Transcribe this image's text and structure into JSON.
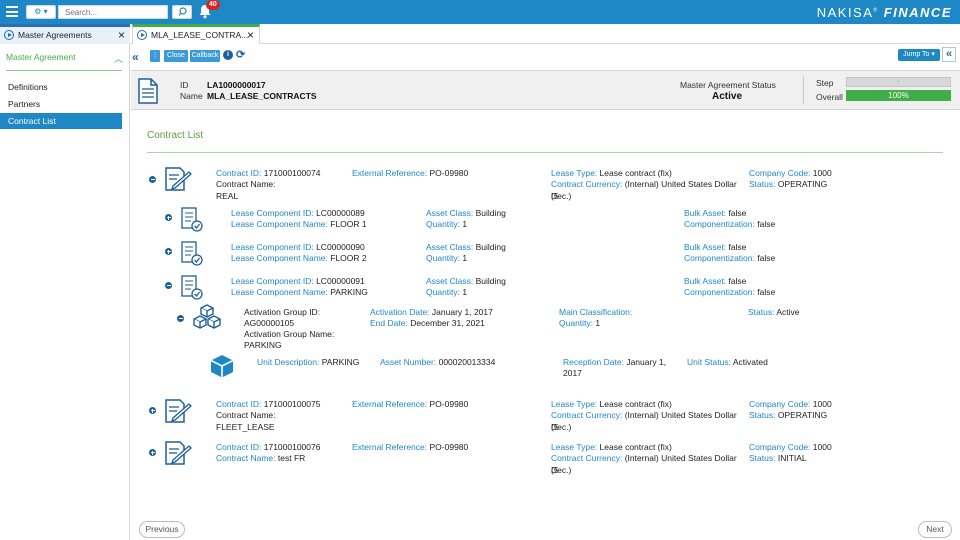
{
  "topbar": {
    "search_placeholder": "Search...",
    "notification_count": "40",
    "brand_name": "NAKISA",
    "brand_suffix": "FINANCE",
    "accent_color": "#1e88c7"
  },
  "tabs": [
    {
      "label": "Master Agreements",
      "close": "×"
    },
    {
      "label": "MLA_LEASE_CONTRA...",
      "close": "×"
    }
  ],
  "sidebar": {
    "header": "Master Agreement",
    "items": [
      {
        "label": "Definitions",
        "active": false
      },
      {
        "label": "Partners",
        "active": false
      },
      {
        "label": "Contract List",
        "active": true
      }
    ]
  },
  "toolbar": {
    "close_label": "Close",
    "callback_label": "Callback",
    "jump_label": "Jump To ▾"
  },
  "header": {
    "id_label": "ID",
    "id_value": "LA1000000017",
    "name_label": "Name",
    "name_value": "MLA_LEASE_CONTRACTS",
    "status_label": "Master Agreement Status",
    "status_value": "Active",
    "step_label": "Step",
    "step_value": "-",
    "overall_label": "Overall",
    "overall_value": "100%",
    "overall_progress": 1.0
  },
  "section_title": "Contract List",
  "contracts": [
    {
      "id_label": "Contract ID:",
      "id": "171000100074",
      "name_label": "Contract Name:",
      "name": "REAL",
      "ext_label": "External Reference:",
      "ext": "PO-09980",
      "lease_type_label": "Lease Type:",
      "lease_type": "Lease contract (fix)",
      "currency_label": "Contract Currency:",
      "currency": "(Internal) United States Dollar (5",
      "currency_cont": "Dec.)",
      "company_label": "Company Code:",
      "company": "1000",
      "status_label": "Status:",
      "status": "OPERATING"
    },
    {
      "id_label": "Contract ID:",
      "id": "171000100075",
      "name_label": "Contract Name:",
      "name": "FLEET_LEASE",
      "ext_label": "External Reference:",
      "ext": "PO-09980",
      "lease_type_label": "Lease Type:",
      "lease_type": "Lease contract (fix)",
      "currency_label": "Contract Currency:",
      "currency": "(Internal) United States Dollar (5",
      "currency_cont": "Dec.)",
      "company_label": "Company Code:",
      "company": "1000",
      "status_label": "Status:",
      "status": "OPERATING"
    },
    {
      "id_label": "Contract ID:",
      "id": "171000100076",
      "name_label": "Contract Name:",
      "name": "test FR",
      "ext_label": "External Reference:",
      "ext": "PO-09980",
      "lease_type_label": "Lease Type:",
      "lease_type": "Lease contract (fix)",
      "currency_label": "Contract Currency:",
      "currency": "(Internal) United States Dollar (5",
      "currency_cont": "Dec.)",
      "company_label": "Company Code:",
      "company": "1000",
      "status_label": "Status:",
      "status": "INITIAL"
    }
  ],
  "components": [
    {
      "id_label": "Lease Component ID:",
      "id": "LC00000089",
      "name_label": "Lease Component Name:",
      "name": "FLOOR 1",
      "class_label": "Asset Class:",
      "class": "Building",
      "qty_label": "Quantity:",
      "qty": "1",
      "bulk_label": "Bulk Asset:",
      "bulk": "false",
      "comp_label": "Componentization:",
      "comp": "false"
    },
    {
      "id_label": "Lease Component ID:",
      "id": "LC00000090",
      "name_label": "Lease Component Name:",
      "name": "FLOOR 2",
      "class_label": "Asset Class:",
      "class": "Building",
      "qty_label": "Quantity:",
      "qty": "1",
      "bulk_label": "Bulk Asset:",
      "bulk": "false",
      "comp_label": "Componentization:",
      "comp": "false"
    },
    {
      "id_label": "Lease Component ID:",
      "id": "LC00000091",
      "name_label": "Lease Component Name:",
      "name": "PARKING",
      "class_label": "Asset Class:",
      "class": "Building",
      "qty_label": "Quantity:",
      "qty": "1",
      "bulk_label": "Bulk Asset:",
      "bulk": "false",
      "comp_label": "Componentization:",
      "comp": "false"
    }
  ],
  "activation_group": {
    "id_label": "Activation Group ID:",
    "id": "AG00000105",
    "name_label": "Activation Group Name:",
    "name": "PARKING",
    "act_date_label": "Activation Date:",
    "act_date": "January 1, 2017",
    "end_date_label": "End Date:",
    "end_date": "December 31, 2021",
    "main_class_label": "Main Classification:",
    "main_class": "",
    "qty_label": "Quantity:",
    "qty": "1",
    "status_label": "Status:",
    "status": "Active"
  },
  "unit": {
    "desc_label": "Unit Description:",
    "desc": "PARKING",
    "asset_label": "Asset Number:",
    "asset": "000020013334",
    "reception_label": "Reception Date:",
    "reception": "January 1,",
    "reception_cont": "2017",
    "status_label": "Unit Status:",
    "status": "Activated"
  },
  "pager": {
    "previous": "Previous",
    "next": "Next"
  }
}
